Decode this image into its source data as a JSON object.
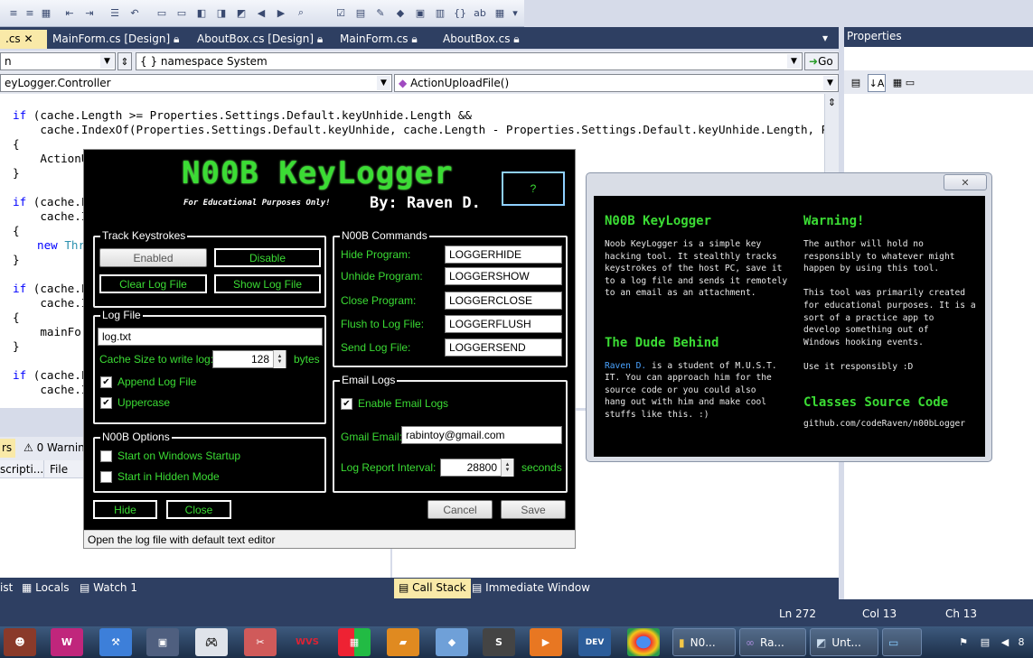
{
  "ide": {
    "tabs": [
      {
        "label": ".cs"
      },
      {
        "label": "MainForm.cs [Design]"
      },
      {
        "label": "AboutBox.cs [Design]"
      },
      {
        "label": "MainForm.cs"
      },
      {
        "label": "AboutBox.cs"
      }
    ],
    "nav": {
      "project_combo": "n",
      "namespace_combo": "namespace System",
      "class_combo": "eyLogger.Controller",
      "member_combo": "ActionUploadFile()",
      "go_label": "Go"
    },
    "code_lines": [
      {
        "kw": "if",
        "text": " (cache.Length >= Properties.Settings.Default.keyUnhide.Length &&"
      },
      {
        "kw": "",
        "text": "    cache.IndexOf(Properties.Settings.Default.keyUnhide, cache.Length - Properties.Settings.Default.keyUnhide.Length, Properties"
      },
      {
        "kw": "",
        "text": "{"
      },
      {
        "kw": "",
        "text": "    ActionU"
      },
      {
        "kw": "",
        "text": "}"
      },
      {
        "kw": "",
        "text": ""
      },
      {
        "kw": "if",
        "text": " (cache.Le"
      },
      {
        "kw": "",
        "text": "    cache.In"
      },
      {
        "kw": "",
        "text": "{"
      },
      {
        "kw": "new",
        "text": " Thre"
      },
      {
        "kw": "",
        "text": "}"
      },
      {
        "kw": "",
        "text": ""
      },
      {
        "kw": "if",
        "text": " (cache.Le"
      },
      {
        "kw": "",
        "text": "    cache.In"
      },
      {
        "kw": "",
        "text": "{"
      },
      {
        "kw": "",
        "text": "    mainFor"
      },
      {
        "kw": "",
        "text": "}"
      },
      {
        "kw": "",
        "text": ""
      },
      {
        "kw": "if",
        "text": " (cache.Le"
      },
      {
        "kw": "",
        "text": "    cache.In"
      }
    ],
    "properties_title": "Properties",
    "bottom_tabs_left": [
      "rs",
      "0 Warnin"
    ],
    "bottom_columns": [
      "scripti...",
      "File"
    ],
    "bottom_panel_tabs_left": [
      "ist",
      "Locals",
      "Watch 1"
    ],
    "bottom_panel_tabs_right": [
      "Call Stack",
      "Immediate Window"
    ],
    "status": {
      "ln": "Ln 272",
      "col": "Col 13",
      "ch": "Ch 13"
    }
  },
  "main_form": {
    "logo_title": "N00B KeyLogger",
    "logo_sub": "For Educational Purposes Only!",
    "logo_author": "By: Raven D.",
    "help_button": "?",
    "track_group": {
      "title": "Track Keystrokes",
      "enabled": "Enabled",
      "disable": "Disable",
      "clear_log": "Clear Log File",
      "show_log": "Show Log File"
    },
    "log_group": {
      "title": "Log File",
      "path": "log.txt",
      "cache_label": "Cache Size to write log:",
      "cache_value": "128",
      "cache_unit": "bytes",
      "append_label": "Append Log File",
      "uppercase_label": "Uppercase"
    },
    "options_group": {
      "title": "N00B Options",
      "startup_label": "Start on Windows Startup",
      "hidden_label": "Start in Hidden Mode"
    },
    "commands_group": {
      "title": "N00B Commands",
      "rows": [
        {
          "label": "Hide Program:",
          "value": "LOGGERHIDE"
        },
        {
          "label": "Unhide Program:",
          "value": "LOGGERSHOW"
        },
        {
          "label": "Close Program:",
          "value": "LOGGERCLOSE"
        },
        {
          "label": "Flush to Log File:",
          "value": "LOGGERFLUSH"
        },
        {
          "label": "Send Log File:",
          "value": "LOGGERSEND"
        }
      ]
    },
    "email_group": {
      "title": "Email Logs",
      "enable_label": "Enable Email Logs",
      "gmail_label": "Gmail Email:",
      "gmail_value": "rabintoy@gmail.com",
      "interval_label": "Log Report Interval:",
      "interval_value": "28800",
      "interval_unit": "seconds"
    },
    "hide": "Hide",
    "close": "Close",
    "cancel": "Cancel",
    "save": "Save",
    "status_text": "Open the log file with default text editor"
  },
  "about": {
    "close_glyph": "✕",
    "title1": "N00B KeyLogger",
    "text1": "Noob KeyLogger is a simple key\nhacking tool. It stealthly tracks\nkeystrokes of the host PC, save it\nto a log file and sends it remotely\nto an email as an attachment.",
    "title2": "The Dude Behind",
    "name": "Raven D.",
    "text2a": " is a student of M.U.S.T.",
    "text2b": "IT. You can approach him for the\nsource code or you could also\nhang out with him and make cool\nstuffs like this. :)",
    "title3": "Warning!",
    "text3": "The author will hold no\nresponsibly to whatever might\nhappen by using this tool.\n\nThis tool was primarily created\nfor educational purposes. It is a\nsort of a practice app to\ndevelop something out of\nWindows hooking events.\n\nUse it responsibly :D",
    "title4": "Classes Source Code",
    "text4": "github.com/codeRaven/n00bLogger"
  },
  "taskbar": {
    "groups": [
      "N0...",
      "Ra...",
      "Unt..."
    ],
    "tray_text": "8"
  }
}
